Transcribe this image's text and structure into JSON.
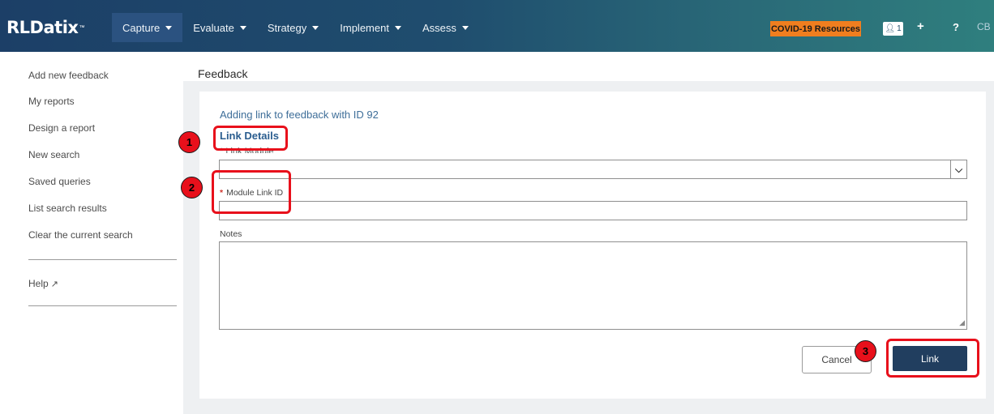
{
  "header": {
    "logo": "RLDatix",
    "logo_tm": "™",
    "nav": [
      {
        "label": "Capture",
        "active": true
      },
      {
        "label": "Evaluate",
        "active": false
      },
      {
        "label": "Strategy",
        "active": false
      },
      {
        "label": "Implement",
        "active": false
      },
      {
        "label": "Assess",
        "active": false
      }
    ],
    "covid_button": "COVID-19 Resources",
    "user_badge": "1",
    "add_icon": "+",
    "help_icon": "?",
    "user_initials": "CB"
  },
  "sidebar": {
    "links": [
      "Add new feedback",
      "My reports",
      "Design a report",
      "New search",
      "Saved queries",
      "List search results",
      "Clear the current search"
    ],
    "help_label": "Help",
    "help_icon": "external-link-icon"
  },
  "page": {
    "title": "Feedback",
    "heading": "Adding link to feedback with ID 92",
    "section_title": "Link Details",
    "link_module_label": "* Link Module",
    "module_link_id_label": "Module Link ID",
    "notes_label": "Notes",
    "cancel_label": "Cancel",
    "link_label": "Link"
  },
  "annotations": [
    {
      "number": "1"
    },
    {
      "number": "2"
    },
    {
      "number": "3"
    }
  ],
  "colors": {
    "header_gradient_start": "#1c3f67",
    "header_gradient_end": "#2f7f7e",
    "covid_orange": "#f07e1f",
    "primary_button": "#213e5f",
    "annotation_red": "#e8101b",
    "section_blue": "#2a5d8f"
  }
}
